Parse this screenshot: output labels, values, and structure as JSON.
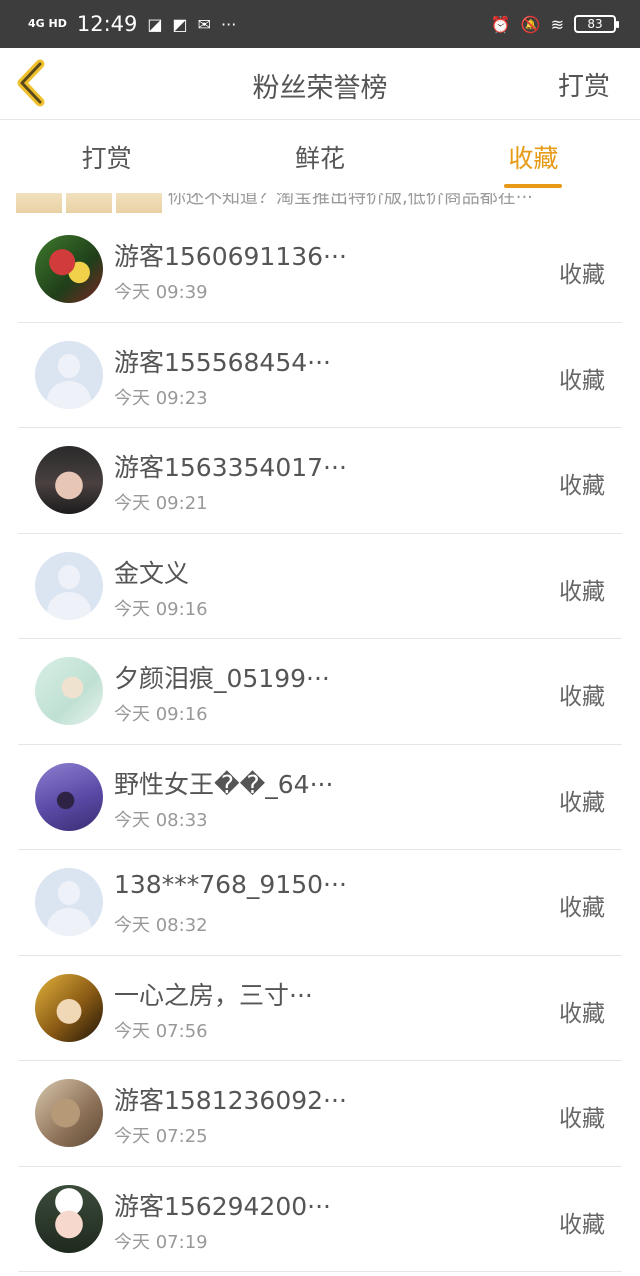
{
  "status_bar": {
    "signal": "4G HD",
    "time": "12:49",
    "left_icons": [
      "app-icon",
      "app-icon",
      "wechat-icon"
    ],
    "more": "···",
    "right_icons": [
      "alarm-icon",
      "mute-icon",
      "wifi-icon"
    ],
    "battery": "83"
  },
  "nav": {
    "title": "粉丝荣誉榜",
    "action": "打赏",
    "accent": "#e69a16"
  },
  "tabs": [
    {
      "label": "打赏",
      "active": false
    },
    {
      "label": "鲜花",
      "active": false
    },
    {
      "label": "收藏",
      "active": true
    }
  ],
  "ad": {
    "text": "你还不知道？淘宝推出特价版,低价商品都在···"
  },
  "fans": [
    {
      "name": "游客1560691136···",
      "time": "今天 09:39",
      "action": "收藏",
      "avatar": "photo-avatar"
    },
    {
      "name": "游客155568454···",
      "time": "今天 09:23",
      "action": "收藏",
      "avatar": "default-avatar"
    },
    {
      "name": "游客1563354017···",
      "time": "今天 09:21",
      "action": "收藏",
      "avatar": "photo-avatar"
    },
    {
      "name": "金文义",
      "time": "今天 09:16",
      "action": "收藏",
      "avatar": "default-avatar"
    },
    {
      "name": "夕颜泪痕_05199···",
      "time": "今天 09:16",
      "action": "收藏",
      "avatar": "photo-avatar"
    },
    {
      "name": "野性女王��_64···",
      "time": "今天 08:33",
      "action": "收藏",
      "avatar": "photo-avatar"
    },
    {
      "name": "138***768_9150···",
      "time": "今天 08:32",
      "action": "收藏",
      "avatar": "default-avatar"
    },
    {
      "name": "一心之房，三寸···",
      "time": "今天 07:56",
      "action": "收藏",
      "avatar": "photo-avatar"
    },
    {
      "name": "游客1581236092···",
      "time": "今天 07:25",
      "action": "收藏",
      "avatar": "photo-avatar"
    },
    {
      "name": "游客156294200···",
      "time": "今天 07:19",
      "action": "收藏",
      "avatar": "photo-avatar"
    }
  ]
}
